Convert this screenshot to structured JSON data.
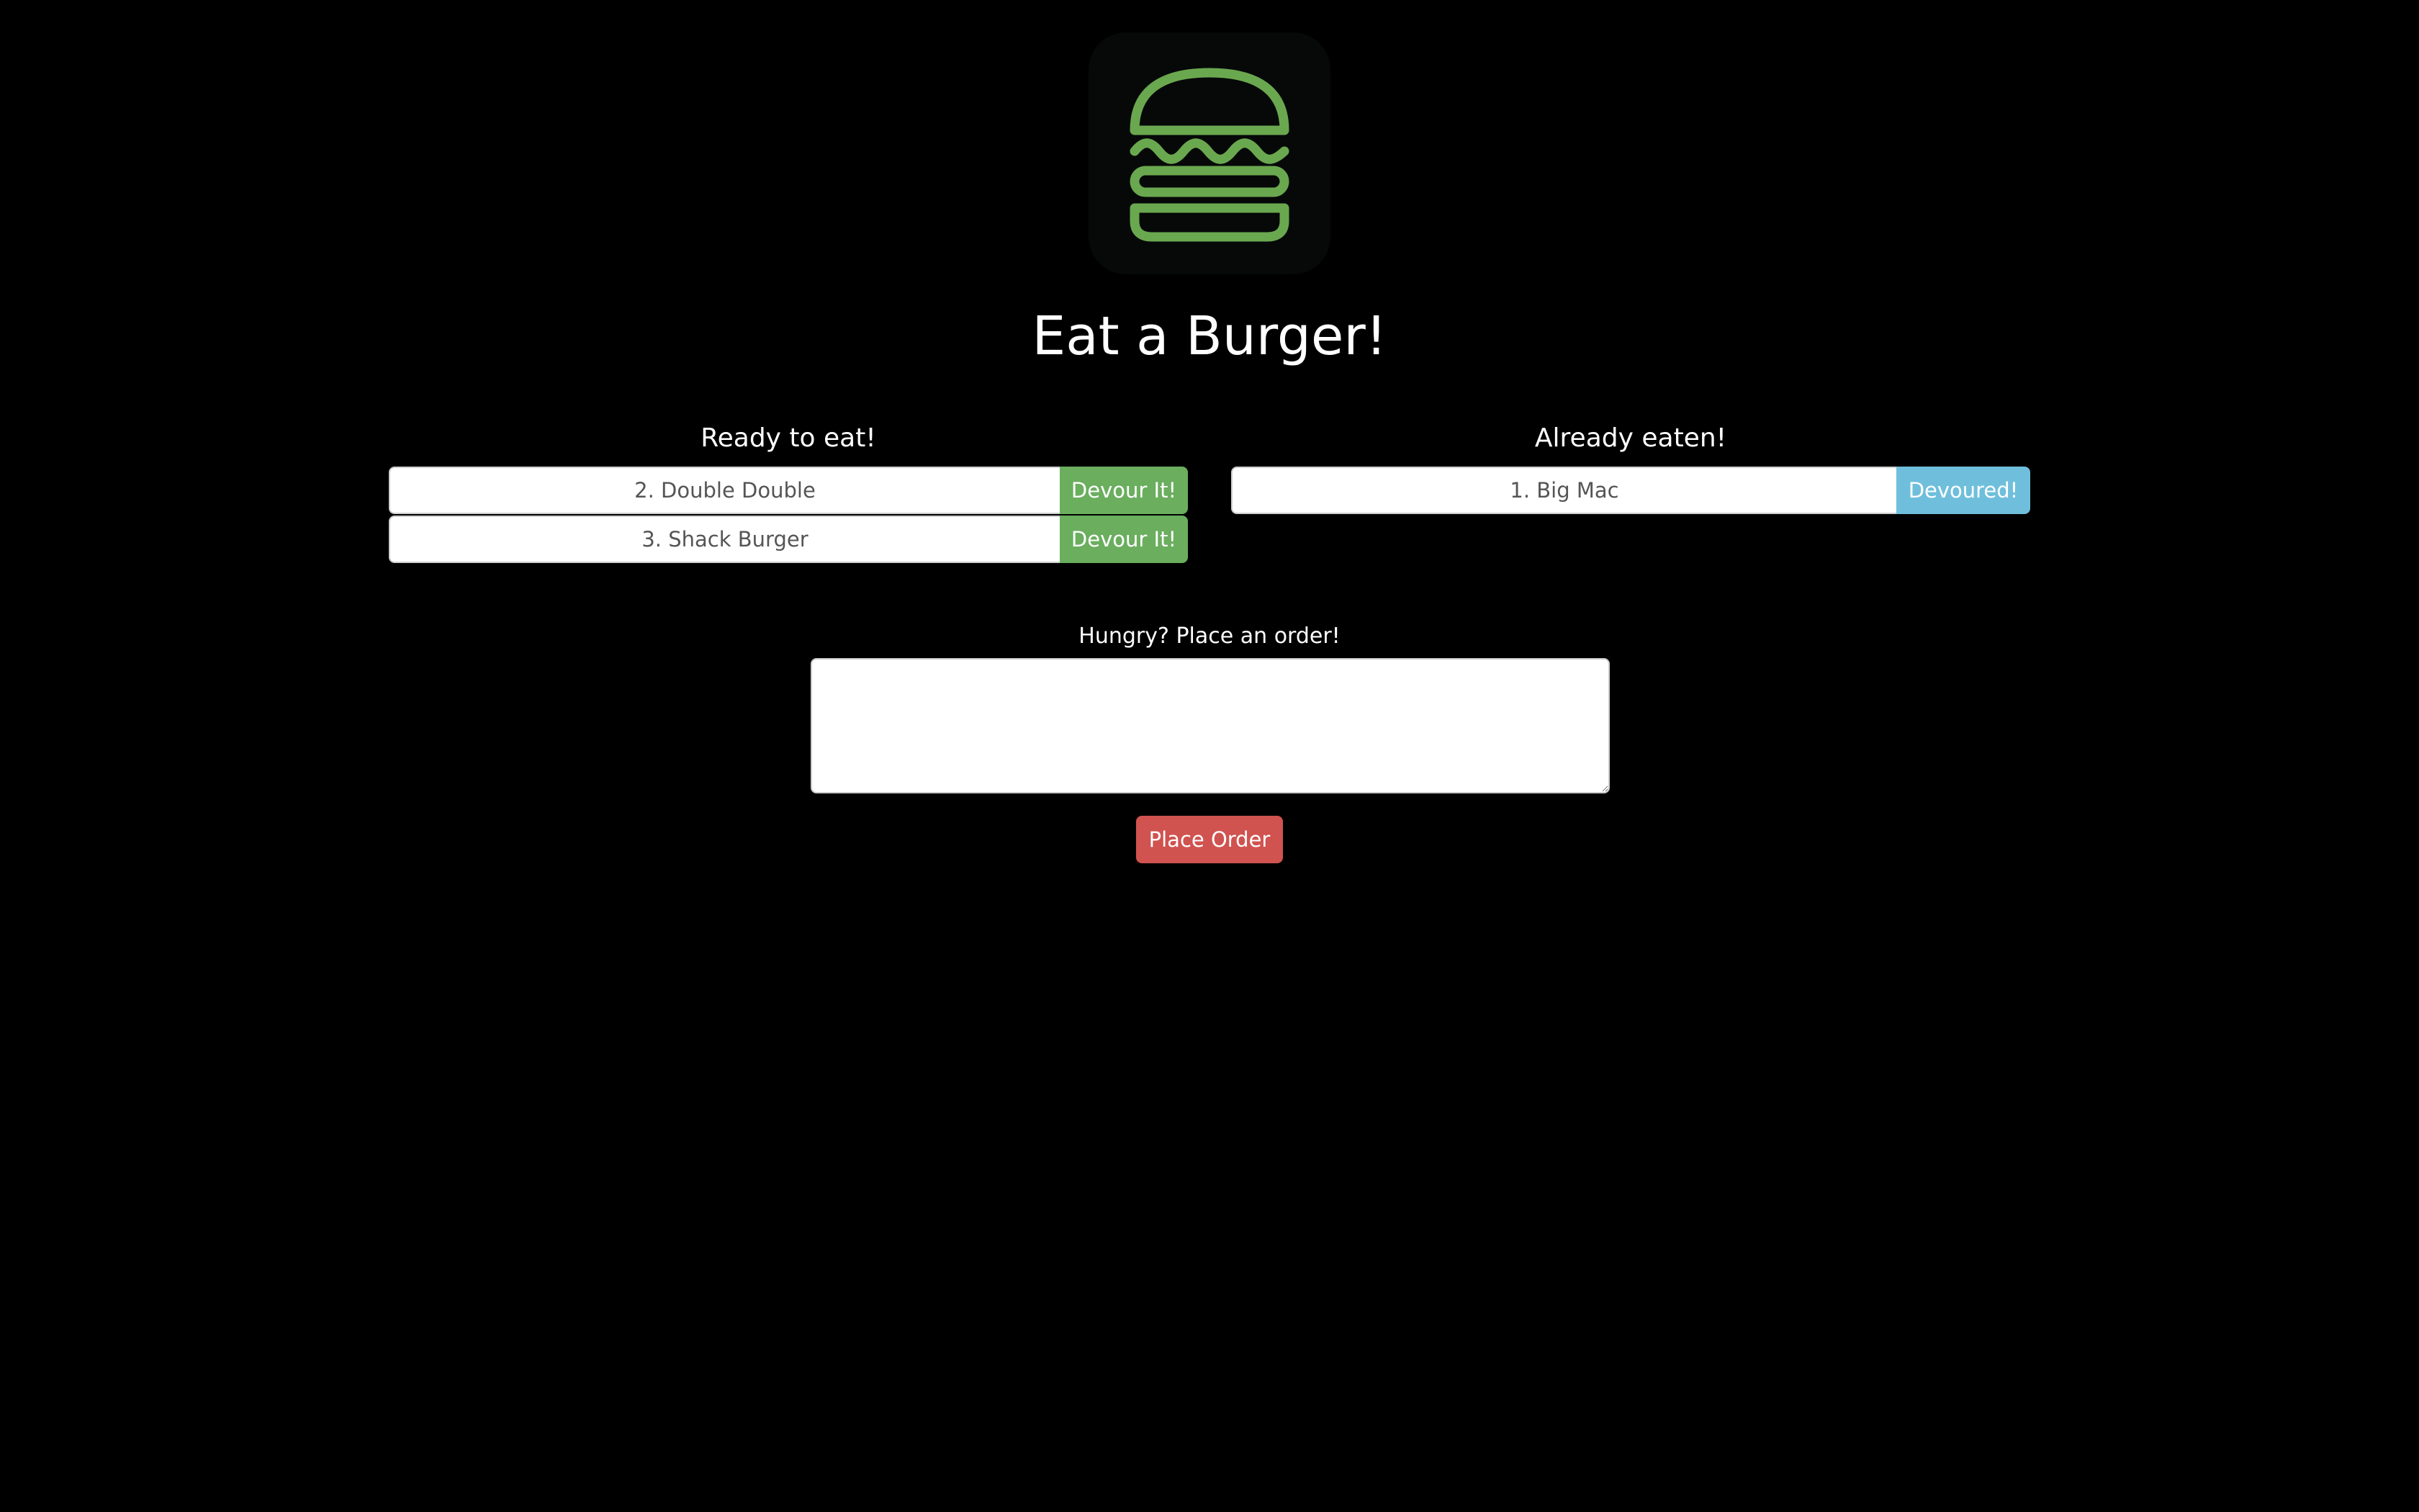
{
  "header": {
    "logo_icon": "burger-icon",
    "logo_color": "#6aa84f",
    "title": "Eat a Burger!"
  },
  "ready": {
    "heading": "Ready to eat!",
    "items": [
      {
        "label": "2. Double Double",
        "button": "Devour It!"
      },
      {
        "label": "3. Shack Burger",
        "button": "Devour It!"
      }
    ]
  },
  "eaten": {
    "heading": "Already eaten!",
    "items": [
      {
        "label": "1. Big Mac",
        "button": "Devoured!"
      }
    ]
  },
  "order": {
    "label": "Hungry? Place an order!",
    "textarea_value": "",
    "button": "Place Order"
  },
  "colors": {
    "background": "#000000",
    "devour_button": "#6aae5e",
    "devoured_button": "#6fbfdc",
    "place_order_button": "#d0534f"
  }
}
